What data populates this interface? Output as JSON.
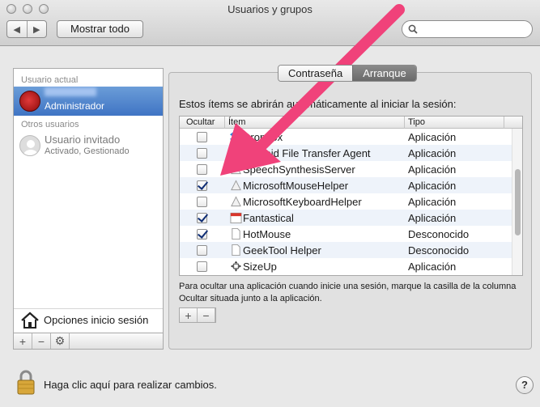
{
  "window": {
    "title": "Usuarios y grupos"
  },
  "toolbar": {
    "back_glyph": "◀",
    "forward_glyph": "▶",
    "show_all_label": "Mostrar todo",
    "search_placeholder": "",
    "search_icon": "search-icon"
  },
  "sidebar": {
    "current_user_header": "Usuario actual",
    "current_user": {
      "name": "",
      "role": "Administrador",
      "avatar": "red-rose-avatar"
    },
    "other_users_header": "Otros usuarios",
    "guest_user": {
      "name": "Usuario invitado",
      "status": "Activado, Gestionado",
      "avatar": "generic-user-avatar"
    },
    "login_options_label": "Opciones inicio sesión",
    "buttons": [
      "+",
      "−",
      "⚙"
    ]
  },
  "tabs": [
    {
      "label": "Contraseña",
      "active": false
    },
    {
      "label": "Arranque",
      "active": true
    }
  ],
  "startup": {
    "intro": "Estos ítems se abrirán automáticamente al iniciar la sesión:",
    "columns": {
      "hide": "Ocultar",
      "item": "Ítem",
      "type": "Tipo"
    },
    "items": [
      {
        "name": "Dropbox",
        "type": "Aplicación",
        "hidden": false,
        "icon": "dropbox-icon"
      },
      {
        "name": "Android File Transfer Agent",
        "type": "Aplicación",
        "hidden": false,
        "icon": "android-icon"
      },
      {
        "name": "SpeechSynthesisServer",
        "type": "Aplicación",
        "hidden": false,
        "icon": "app-generic-icon"
      },
      {
        "name": "MicrosoftMouseHelper",
        "type": "Aplicación",
        "hidden": true,
        "icon": "app-generic-icon"
      },
      {
        "name": "MicrosoftKeyboardHelper",
        "type": "Aplicación",
        "hidden": false,
        "icon": "app-generic-icon"
      },
      {
        "name": "Fantastical",
        "type": "Aplicación",
        "hidden": true,
        "icon": "calendar-icon"
      },
      {
        "name": "HotMouse",
        "type": "Desconocido",
        "hidden": true,
        "icon": "document-icon"
      },
      {
        "name": "GeekTool Helper",
        "type": "Desconocido",
        "hidden": false,
        "icon": "document-icon"
      },
      {
        "name": "SizeUp",
        "type": "Aplicación",
        "hidden": false,
        "icon": "move-arrows-icon"
      }
    ],
    "help_text": "Para ocultar una aplicación cuando inicie una sesión, marque la casilla de la columna Ocultar situada junto a la aplicación.",
    "buttons": [
      "+",
      "−"
    ]
  },
  "footer": {
    "lock_text": "Haga clic aquí para realizar cambios.",
    "help_label": "?"
  },
  "colors": {
    "selection": "#3f74c4",
    "annotation_arrow": "#f0427a",
    "checkmark": "#0e2d74"
  }
}
